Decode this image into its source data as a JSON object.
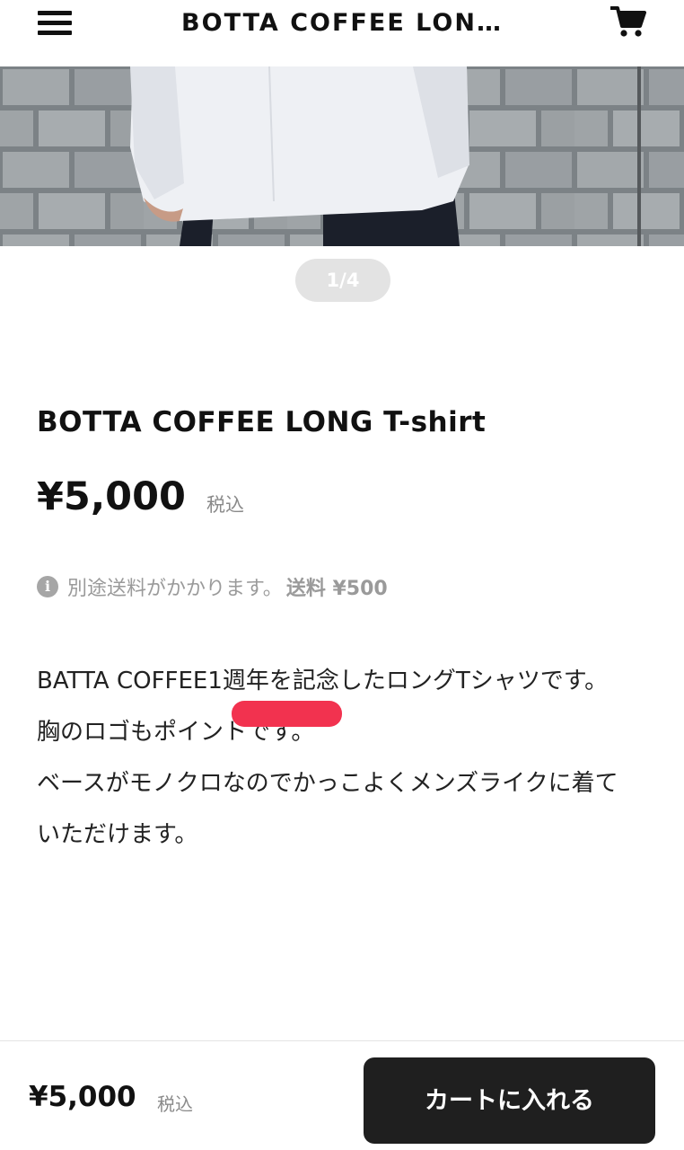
{
  "header": {
    "title": "BOTTA COFFEE LON…",
    "menu_icon": "hamburger-menu-icon",
    "cart_icon": "shopping-cart-icon"
  },
  "gallery": {
    "pager": "1/4"
  },
  "product": {
    "title": "BOTTA COFFEE LONG T-shirt",
    "price": "¥5,000",
    "tax_label": "税込",
    "shipping_icon": "info-icon",
    "shipping_note": "別途送料がかかります。",
    "shipping_fee": "送料 ¥500",
    "description": [
      "BATTA COFFEE1週年を記念したロングTシャツです。",
      "胸のロゴもポイントです。",
      "ベースがモノクロなのでかっこよくメンズライクに着ていただけます。"
    ]
  },
  "bottom_bar": {
    "price": "¥5,000",
    "tax_label": "税込",
    "cart_button": "カートに入れる"
  },
  "colors": {
    "button_bg": "#1f1f1f",
    "annotation_red": "#f2324f",
    "pager_bg": "#e3e3e3"
  }
}
